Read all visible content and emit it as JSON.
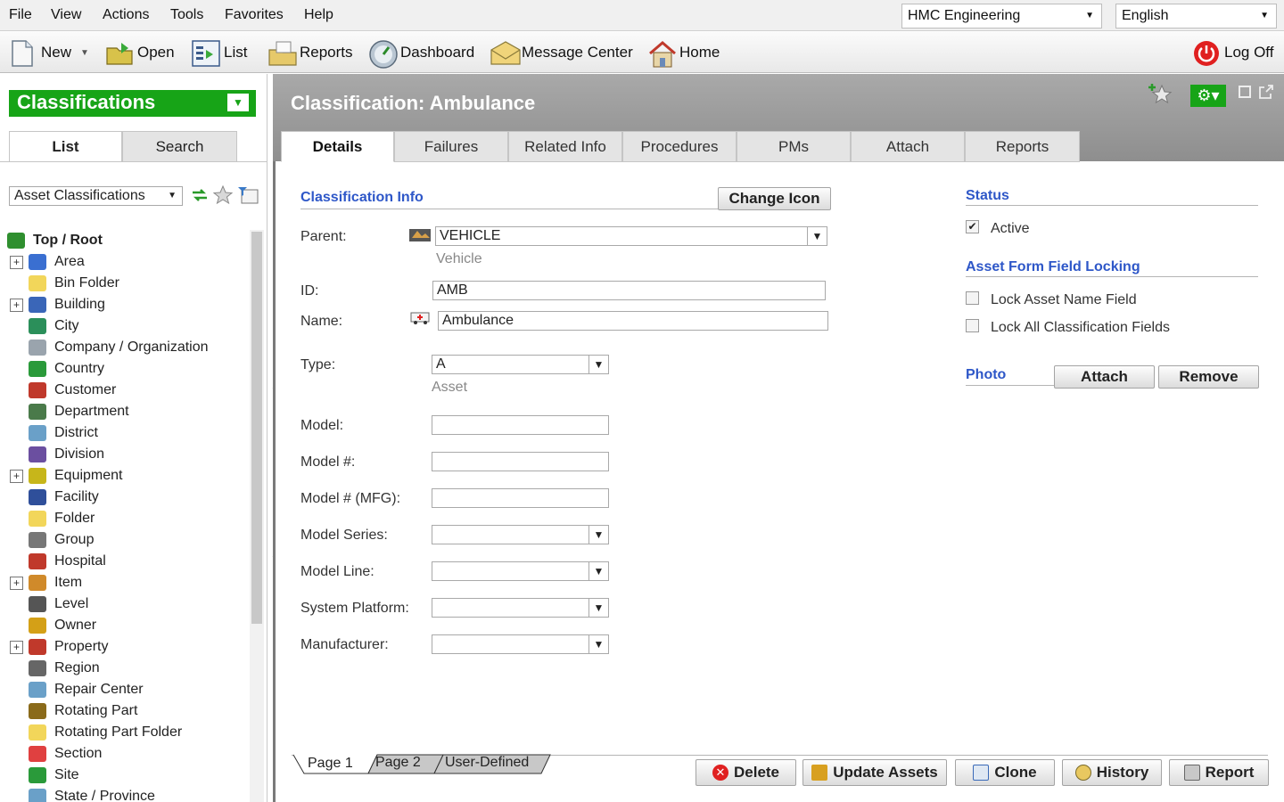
{
  "menu": {
    "items": [
      "File",
      "View",
      "Actions",
      "Tools",
      "Favorites",
      "Help"
    ],
    "company_select": "HMC Engineering",
    "language_select": "English"
  },
  "toolbar": {
    "new": "New",
    "open": "Open",
    "list": "List",
    "reports": "Reports",
    "dashboard": "Dashboard",
    "message_center": "Message Center",
    "home": "Home",
    "log_off": "Log Off"
  },
  "left": {
    "title": "Classifications",
    "tabs": [
      "List",
      "Search"
    ],
    "asset_select": "Asset Classifications",
    "tree": [
      {
        "label": "Top / Root",
        "expandable": false,
        "root": true,
        "icon": "root-icon",
        "color": "#2f8f2f"
      },
      {
        "label": "Area",
        "expandable": true,
        "icon": "area-icon",
        "color": "#3a6fd1"
      },
      {
        "label": "Bin Folder",
        "expandable": false,
        "icon": "bin-folder-icon",
        "color": "#f2d65a"
      },
      {
        "label": "Building",
        "expandable": true,
        "icon": "building-icon",
        "color": "#3a66b8"
      },
      {
        "label": "City",
        "expandable": false,
        "icon": "city-icon",
        "color": "#2b8f5a"
      },
      {
        "label": "Company / Organization",
        "expandable": false,
        "icon": "company-icon",
        "color": "#9aa4ad"
      },
      {
        "label": "Country",
        "expandable": false,
        "icon": "globe-icon",
        "color": "#2a9a3a"
      },
      {
        "label": "Customer",
        "expandable": false,
        "icon": "customer-icon",
        "color": "#c0392b"
      },
      {
        "label": "Department",
        "expandable": false,
        "icon": "department-icon",
        "color": "#4a7a4a"
      },
      {
        "label": "District",
        "expandable": false,
        "icon": "district-icon",
        "color": "#6aa0c8"
      },
      {
        "label": "Division",
        "expandable": false,
        "icon": "division-icon",
        "color": "#6b4fa0"
      },
      {
        "label": "Equipment",
        "expandable": true,
        "icon": "equipment-icon",
        "color": "#c7b61a"
      },
      {
        "label": "Facility",
        "expandable": false,
        "icon": "facility-icon",
        "color": "#2f4f9a"
      },
      {
        "label": "Folder",
        "expandable": false,
        "icon": "folder-icon",
        "color": "#f2d65a"
      },
      {
        "label": "Group",
        "expandable": false,
        "icon": "group-icon",
        "color": "#777777"
      },
      {
        "label": "Hospital",
        "expandable": false,
        "icon": "hospital-icon",
        "color": "#c0392b"
      },
      {
        "label": "Item",
        "expandable": true,
        "icon": "item-icon",
        "color": "#d08a2a"
      },
      {
        "label": "Level",
        "expandable": false,
        "icon": "level-icon",
        "color": "#555555"
      },
      {
        "label": "Owner",
        "expandable": false,
        "icon": "owner-icon",
        "color": "#d4a017"
      },
      {
        "label": "Property",
        "expandable": true,
        "icon": "property-icon",
        "color": "#c0392b"
      },
      {
        "label": "Region",
        "expandable": false,
        "icon": "region-icon",
        "color": "#666666"
      },
      {
        "label": "Repair Center",
        "expandable": false,
        "icon": "repair-center-icon",
        "color": "#6aa0c8"
      },
      {
        "label": "Rotating Part",
        "expandable": false,
        "icon": "rotating-part-icon",
        "color": "#8a6a1a"
      },
      {
        "label": "Rotating Part Folder",
        "expandable": false,
        "icon": "folder-icon",
        "color": "#f2d65a"
      },
      {
        "label": "Section",
        "expandable": false,
        "icon": "section-icon",
        "color": "#e04040"
      },
      {
        "label": "Site",
        "expandable": false,
        "icon": "site-icon",
        "color": "#2a9a3a"
      },
      {
        "label": "State / Province",
        "expandable": false,
        "icon": "state-icon",
        "color": "#6aa0c8"
      }
    ]
  },
  "main": {
    "title": "Classification:  Ambulance",
    "tabs": [
      "Details",
      "Failures",
      "Related Info",
      "Procedures",
      "PMs",
      "Attach",
      "Reports"
    ],
    "classification_info": "Classification Info",
    "change_icon": "Change Icon",
    "parent_label": "Parent:",
    "parent_value": "VEHICLE",
    "parent_sub": "Vehicle",
    "id_label": "ID:",
    "id_value": "AMB",
    "name_label": "Name:",
    "name_value": "Ambulance",
    "type_label": "Type:",
    "type_value": "A",
    "type_sub": "Asset",
    "model_label": "Model:",
    "model_no_label": "Model #:",
    "model_mfg_label": "Model # (MFG):",
    "model_series_label": "Model Series:",
    "model_line_label": "Model Line:",
    "system_platform_label": "System Platform:",
    "manufacturer_label": "Manufacturer:",
    "status_head": "Status",
    "active_label": "Active",
    "locking_head": "Asset Form Field Locking",
    "lock_name_label": "Lock Asset Name Field",
    "lock_all_label": "Lock All Classification Fields",
    "photo_head": "Photo",
    "attach_btn": "Attach",
    "remove_btn": "Remove",
    "page_tabs": [
      "Page 1",
      "Page 2",
      "User-Defined"
    ],
    "delete_btn": "Delete",
    "update_assets_btn": "Update Assets",
    "clone_btn": "Clone",
    "history_btn": "History",
    "report_btn": "Report"
  }
}
